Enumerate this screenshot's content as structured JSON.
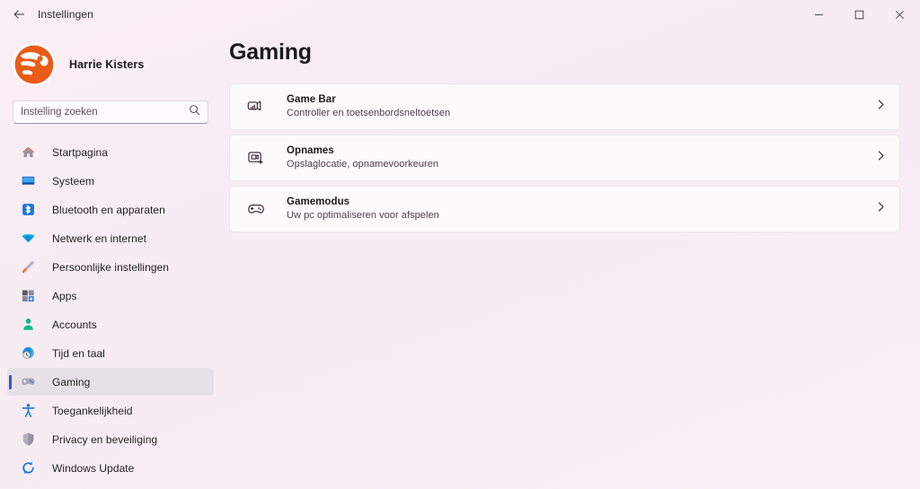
{
  "window": {
    "title": "Instellingen",
    "back_icon": "back-arrow-icon",
    "minimize_label": "–",
    "maximize_label": "□",
    "close_label": "✕"
  },
  "sidebar": {
    "account": {
      "name": "Harrie Kisters",
      "avatar_icon": "user-avatar-logo",
      "avatar_color": "#ea5b17"
    },
    "search": {
      "placeholder": "Instelling zoeken",
      "value": "",
      "icon": "search-icon"
    },
    "items": [
      {
        "label": "Startpagina",
        "icon": "home-icon",
        "selected": false
      },
      {
        "label": "Systeem",
        "icon": "monitor-icon",
        "selected": false
      },
      {
        "label": "Bluetooth en apparaten",
        "icon": "bluetooth-icon",
        "selected": false
      },
      {
        "label": "Netwerk en internet",
        "icon": "wifi-icon",
        "selected": false
      },
      {
        "label": "Persoonlijke instellingen",
        "icon": "paintbrush-icon",
        "selected": false
      },
      {
        "label": "Apps",
        "icon": "apps-grid-icon",
        "selected": false
      },
      {
        "label": "Accounts",
        "icon": "person-icon",
        "selected": false
      },
      {
        "label": "Tijd en taal",
        "icon": "clock-globe-icon",
        "selected": false
      },
      {
        "label": "Gaming",
        "icon": "gamepad-icon",
        "selected": true
      },
      {
        "label": "Toegankelijkheid",
        "icon": "accessibility-icon",
        "selected": false
      },
      {
        "label": "Privacy en beveiliging",
        "icon": "shield-icon",
        "selected": false
      },
      {
        "label": "Windows Update",
        "icon": "update-refresh-icon",
        "selected": false
      }
    ]
  },
  "main": {
    "page_title": "Gaming",
    "cards": [
      {
        "title": "Game Bar",
        "subtitle": "Controller en toetsenbordsneltoetsen",
        "icon": "game-bar-widget-icon",
        "chevron": "chevron-right-icon"
      },
      {
        "title": "Opnames",
        "subtitle": "Opslaglocatie, opnamevoorkeuren",
        "icon": "screen-capture-icon",
        "chevron": "chevron-right-icon"
      },
      {
        "title": "Gamemodus",
        "subtitle": "Uw pc optimaliseren voor afspelen",
        "icon": "gamepad-outline-icon",
        "chevron": "chevron-right-icon"
      }
    ]
  },
  "colors": {
    "page_background": "#f8ecf3",
    "card_background": "#fdfafc",
    "selection_background": "#e6e1e8",
    "accent_pill": "#3a52cf"
  }
}
